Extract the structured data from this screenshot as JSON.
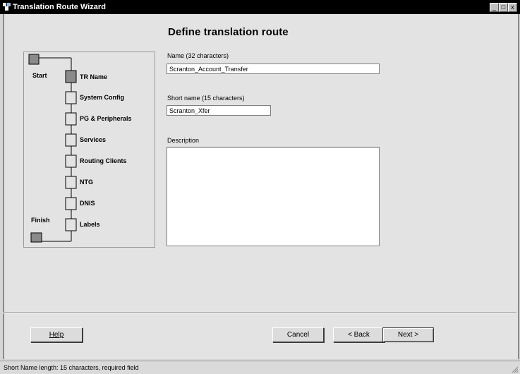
{
  "window": {
    "title": "Translation Route Wizard",
    "buttons": {
      "minimize": "_",
      "maximize": "□",
      "close": "x"
    }
  },
  "page": {
    "title": "Define translation route"
  },
  "steps": {
    "start": "Start",
    "finish": "Finish",
    "items": [
      {
        "label": "TR Name",
        "done": true
      },
      {
        "label": "System Config",
        "done": false
      },
      {
        "label": "PG & Peripherals",
        "done": false
      },
      {
        "label": "Services",
        "done": false
      },
      {
        "label": "Routing Clients",
        "done": false
      },
      {
        "label": "NTG",
        "done": false
      },
      {
        "label": "DNIS",
        "done": false
      },
      {
        "label": "Labels",
        "done": false
      }
    ]
  },
  "form": {
    "name": {
      "label": "Name (32 characters)",
      "value": "Scranton_Account_Transfer"
    },
    "short_name": {
      "label": "Short name (15 characters)",
      "value": "Scranton_Xfer"
    },
    "description": {
      "label": "Description",
      "value": ""
    }
  },
  "buttons": {
    "help": "Help",
    "cancel": "Cancel",
    "back": "< Back",
    "next": "Next >"
  },
  "status": {
    "text": "Short Name length: 15 characters, required field"
  }
}
